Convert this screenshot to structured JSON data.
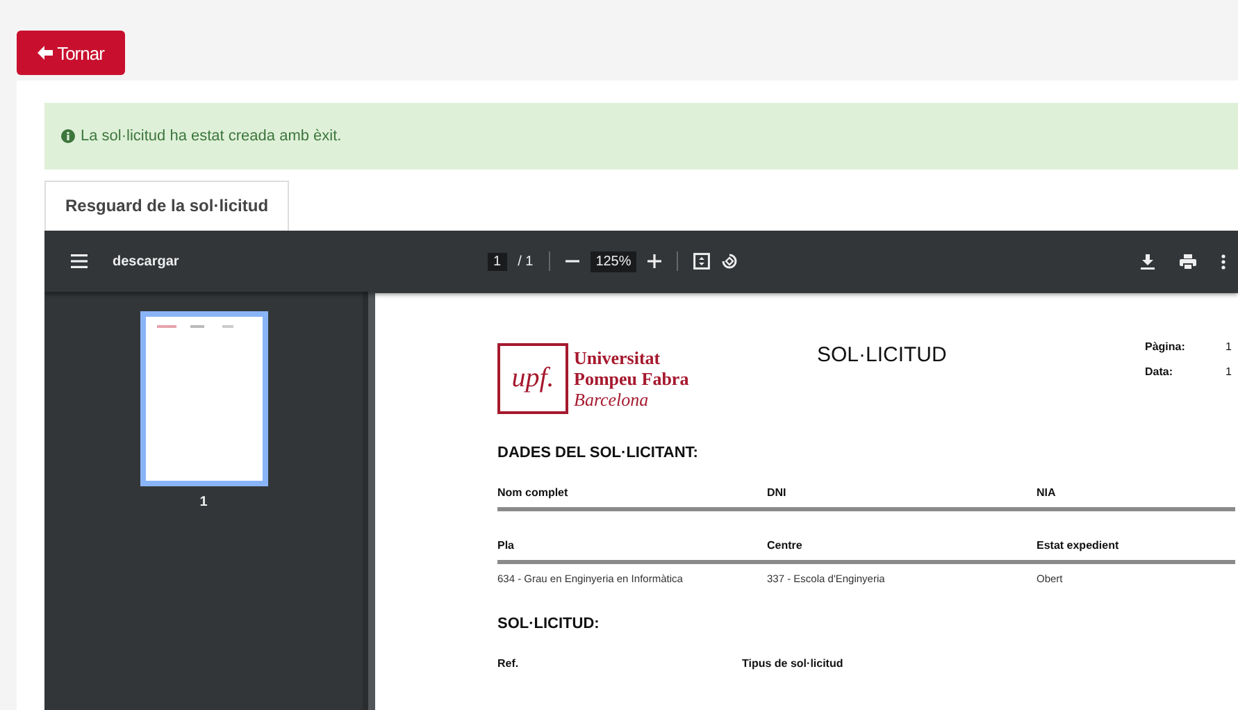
{
  "back_button": {
    "label": "Tornar"
  },
  "alert": {
    "message": "La sol·licitud ha estat creada amb èxit."
  },
  "tabs": [
    {
      "label": "Resguard de la sol·licitud",
      "selected": true
    }
  ],
  "viewer": {
    "toolbar": {
      "title": "descargar",
      "page": "1",
      "page_total": "/ 1",
      "zoom": "125%"
    },
    "thumbnails": [
      {
        "label": "1",
        "selected": true
      }
    ],
    "document": {
      "logo": {
        "mark": "upf.",
        "line_1": "Universitat",
        "line_2": "Pompeu Fabra",
        "line_3": "Barcelona"
      },
      "title": "SOL·LICITUD",
      "meta": [
        {
          "label": "Pàgina:",
          "value": "1"
        },
        {
          "label": "Data:",
          "value": "1"
        }
      ],
      "sections": [
        {
          "heading": "DADES DEL SOL·LICITANT:",
          "tables": [
            {
              "columns": [
                "Nom complet",
                "DNI",
                "NIA"
              ]
            },
            {
              "columns": [
                "Pla",
                "Centre",
                "Estat expedient"
              ],
              "rows": [
                [
                  "634 - Grau en Enginyeria en Informàtica",
                  "337 - Escola d'Enginyeria",
                  "Obert"
                ]
              ]
            }
          ]
        },
        {
          "heading": "SOL·LICITUD:",
          "tables": [
            {
              "columns": [
                "Ref.",
                "Tipus de sol·licitud"
              ]
            }
          ]
        }
      ]
    }
  }
}
